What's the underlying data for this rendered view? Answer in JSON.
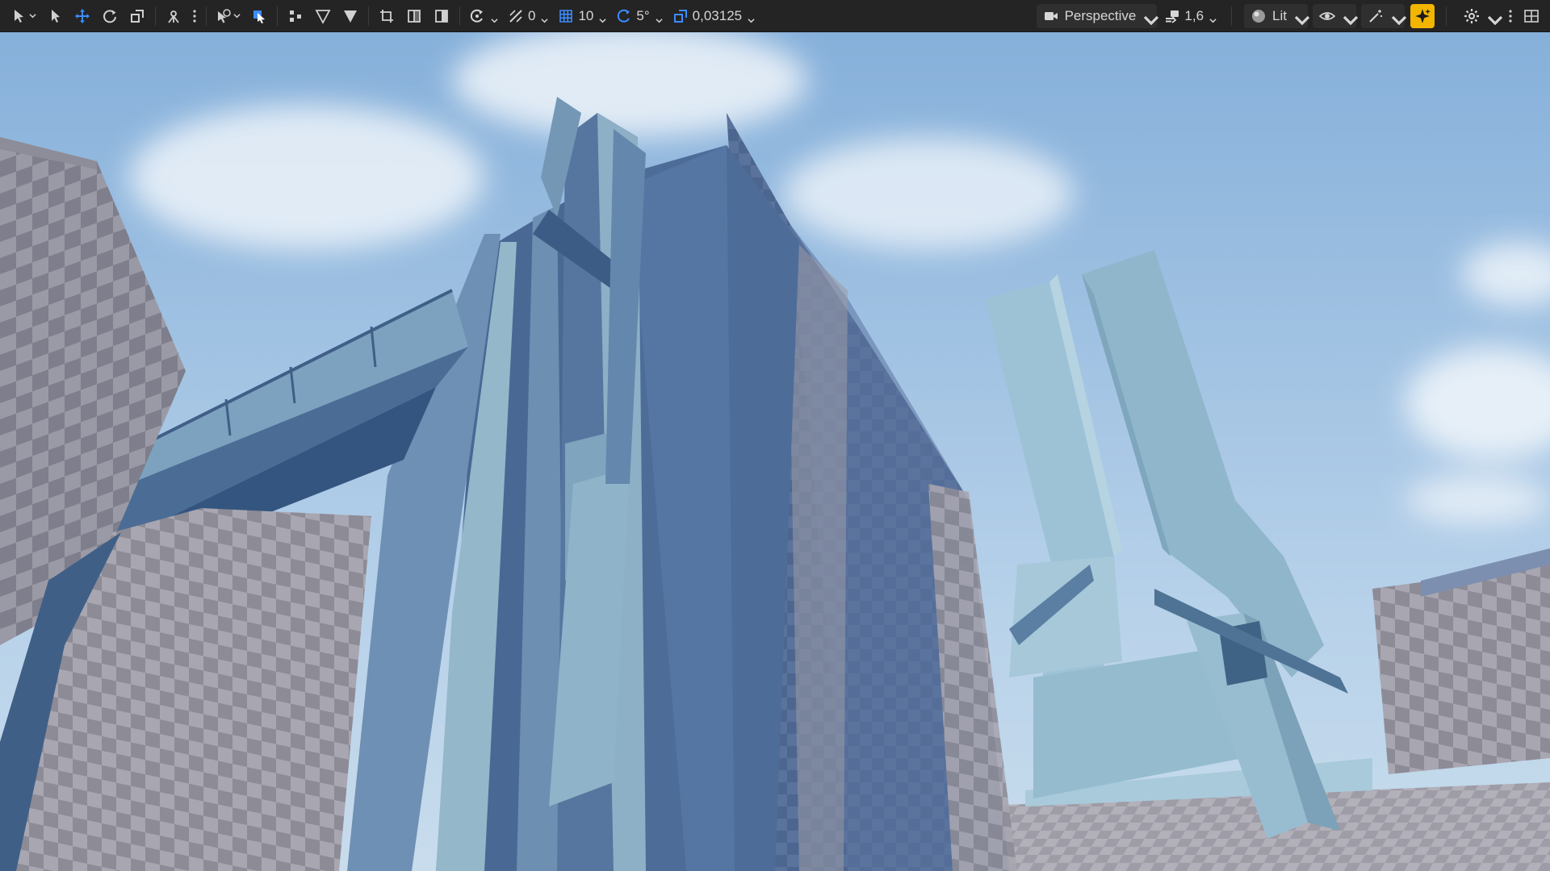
{
  "toolbar": {
    "snap_angle_value": "0",
    "grid_size_value": "10",
    "rotation_snap_value": "5°",
    "scale_snap_value": "0,03125",
    "camera_speed_value": "1,6",
    "view_mode_label": "Lit",
    "viewport_type_label": "Perspective"
  },
  "colors": {
    "toolbar_bg": "#242424",
    "icon": "#d0d0d0",
    "active_icon": "#3d8cff",
    "accent": "#f2b500",
    "sky_top": "#8fb7de",
    "sky_bottom": "#c7dcec",
    "building_dark": "#4f6f9a",
    "building_light": "#8fb4c9",
    "checker_gray": "#8c8c96"
  },
  "icons": {
    "select_mode": "cursor-arrow-icon",
    "translate": "move-arrows-icon",
    "rotate": "rotate-icon",
    "scale": "scale-icon",
    "camera": "video-camera-icon",
    "lit": "sphere-icon",
    "show": "eye-icon",
    "realtime": "sparkle-icon",
    "settings": "gear-icon",
    "layout": "grid-layout-icon"
  }
}
